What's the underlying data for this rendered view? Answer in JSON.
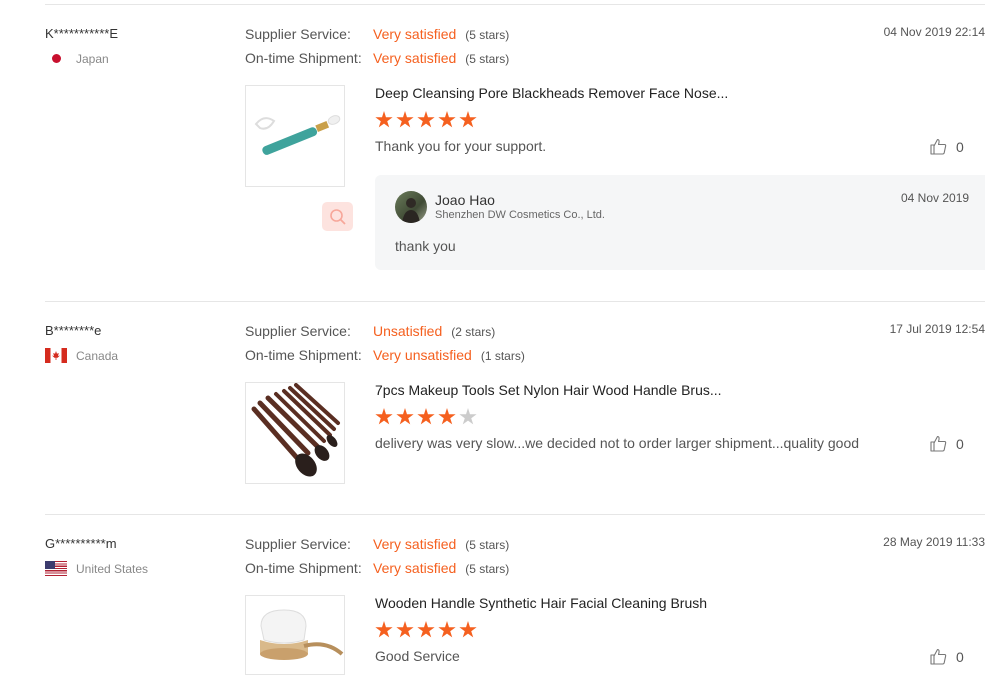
{
  "reviews": [
    {
      "buyer": "K***********E",
      "country": "Japan",
      "supplier_label": "Supplier Service:",
      "supplier_value": "Very satisfied",
      "supplier_stars": "(5 stars)",
      "shipment_label": "On-time Shipment:",
      "shipment_value": "Very satisfied",
      "shipment_stars": "(5 stars)",
      "date": "04 Nov 2019 22:14",
      "product": "Deep Cleansing Pore Blackheads Remover Face Nose...",
      "rating": 5,
      "comment": "Thank you for your support.",
      "likes": "0",
      "reply": {
        "name": "Joao Hao",
        "company": "Shenzhen DW Cosmetics Co., Ltd.",
        "date": "04 Nov 2019",
        "text": "thank you"
      }
    },
    {
      "buyer": "B********e",
      "country": "Canada",
      "supplier_label": "Supplier Service:",
      "supplier_value": "Unsatisfied",
      "supplier_stars": "(2 stars)",
      "shipment_label": "On-time Shipment:",
      "shipment_value": "Very unsatisfied",
      "shipment_stars": "(1 stars)",
      "date": "17 Jul 2019 12:54",
      "product": "7pcs Makeup Tools Set Nylon Hair Wood Handle Brus...",
      "rating": 4,
      "comment": "delivery was very slow...we decided not to order larger shipment...quality good",
      "likes": "0"
    },
    {
      "buyer": "G**********m",
      "country": "United States",
      "supplier_label": "Supplier Service:",
      "supplier_value": "Very satisfied",
      "supplier_stars": "(5 stars)",
      "shipment_label": "On-time Shipment:",
      "shipment_value": "Very satisfied",
      "shipment_stars": "(5 stars)",
      "date": "28 May 2019 11:33",
      "product": "Wooden Handle Synthetic Hair Facial Cleaning Brush",
      "rating": 5,
      "comment": "Good Service",
      "likes": "0"
    }
  ],
  "colors": {
    "accent": "#f5601f",
    "star_empty": "#cccccc",
    "divider": "#e6e6e6",
    "reply_bg": "#f5f6f7"
  },
  "icons": [
    "flag-japan-icon",
    "flag-canada-icon",
    "flag-usa-icon",
    "thumbs-up-icon",
    "magnifier-icon"
  ]
}
